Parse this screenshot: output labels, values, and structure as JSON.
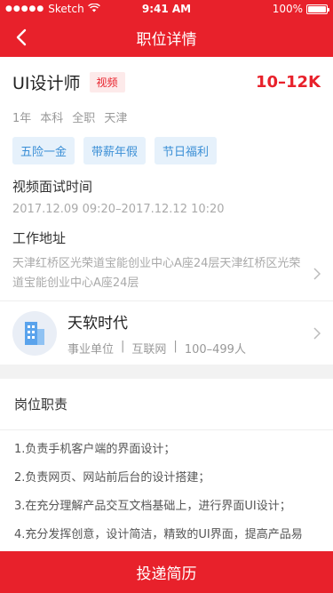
{
  "status": {
    "carrier": "Sketch",
    "time": "9:41 AM",
    "battery": "100%",
    "battery_level": 1.0
  },
  "nav": {
    "title": "职位详情",
    "back_icon": "chevron-left-icon"
  },
  "job": {
    "title": "UI设计师",
    "video_tag": "视频",
    "salary": "10–12K",
    "meta": [
      "1年",
      "本科",
      "全职",
      "天津"
    ],
    "benefits": [
      "五险一金",
      "带薪年假",
      "节日福利"
    ],
    "interview_label": "视频面试时间",
    "interview_time": "2017.12.09 09:20–2017.12.12 10:20",
    "address_label": "工作地址",
    "address": "天津红桥区光荣道宝能创业中心A座24层天津红桥区光荣道宝能创业中心A座24层"
  },
  "company": {
    "name": "天软时代",
    "type": "事业单位",
    "industry": "互联网",
    "size": "100–499人",
    "separator": "|"
  },
  "duties": {
    "title": "岗位职责",
    "items": [
      "1.负责手机客户端的界面设计；",
      "2.负责网页、网站前后台的设计搭建；",
      "3.在充分理解产品交互文档基础上，进行界面UI设计；",
      "4.充分发挥创意，设计简洁，精致的UI界面，提高产品易"
    ]
  },
  "apply_button": "投递简历",
  "colors": {
    "brand": "#e8212b",
    "benefit_text": "#3b8fd6",
    "benefit_bg": "#e6f1fb"
  }
}
